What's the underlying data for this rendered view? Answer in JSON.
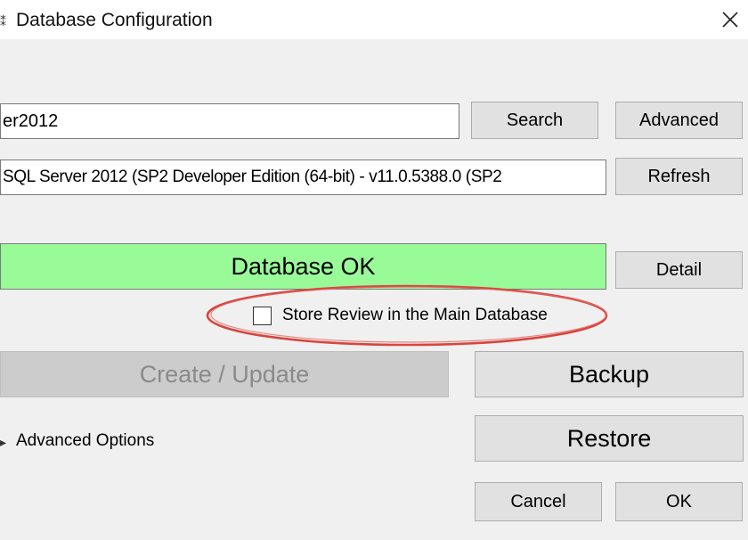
{
  "window": {
    "title": "Database Configuration",
    "title_icon": "app-icon",
    "close_icon": "close-icon"
  },
  "server": {
    "value": "er2012",
    "search_label": "Search",
    "advanced_label": "Advanced"
  },
  "version": {
    "value": " SQL Server 2012 (SP2 Developer Edition (64-bit) - v11.0.5388.0 (SP2",
    "refresh_label": "Refresh"
  },
  "status": {
    "text": "Database OK",
    "color": "#98fb98",
    "detail_label": "Detail"
  },
  "store_review": {
    "label": "Store Review in the Main Database",
    "checked": false,
    "annotation_color": "#d8453f"
  },
  "actions": {
    "create_update_label": "Create / Update",
    "backup_label": "Backup",
    "restore_label": "Restore"
  },
  "advanced_options": {
    "label": "Advanced Options"
  },
  "footer": {
    "cancel_label": "Cancel",
    "ok_label": "OK"
  }
}
